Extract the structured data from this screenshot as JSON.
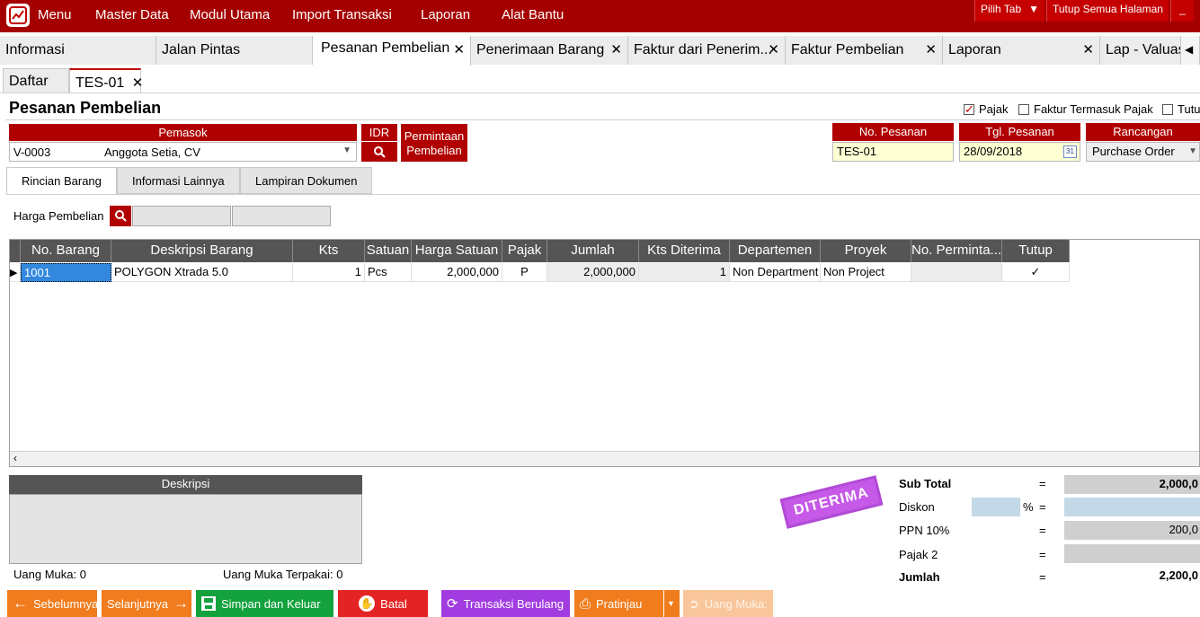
{
  "menubar": {
    "items": [
      "Menu",
      "Master Data",
      "Modul Utama",
      "Import Transaksi",
      "Laporan",
      "Alat Bantu"
    ],
    "pilih_tab": "Pilih Tab",
    "tutup_semua": "Tutup Semua Halaman",
    "minimize": "_",
    "colors": {
      "bar": "#a50000"
    }
  },
  "main_tabs": [
    {
      "label": "Informasi"
    },
    {
      "label": "Jalan Pintas"
    },
    {
      "label": "Pesanan Pembelian",
      "active": true
    },
    {
      "label": "Penerimaan Barang"
    },
    {
      "label": "Faktur dari Penerim..."
    },
    {
      "label": "Faktur Pembelian"
    },
    {
      "label": "Laporan"
    },
    {
      "label": "Lap - Valuas"
    }
  ],
  "sub_tabs": {
    "list": "Daftar",
    "current": "TES-01"
  },
  "form": {
    "title": "Pesanan Pembelian",
    "checkboxes": {
      "pajak": "Pajak",
      "faktur_termasuk_pajak": "Faktur Termasuk Pajak",
      "tutup": "Tutu"
    },
    "pemasok_label": "Pemasok",
    "pemasok_code": "V-0003",
    "pemasok_name": "Anggota Setia, CV",
    "currency": "IDR",
    "permintaan_line1": "Permintaan",
    "permintaan_line2": "Pembelian",
    "no_pesanan_label": "No. Pesanan",
    "no_pesanan": "TES-01",
    "tgl_pesanan_label": "Tgl. Pesanan",
    "tgl_pesanan": "28/09/2018",
    "calendar_day": "31",
    "rancangan_label": "Rancangan",
    "rancangan": "Purchase Order"
  },
  "inner_tabs": [
    "Rincian Barang",
    "Informasi Lainnya",
    "Lampiran Dokumen"
  ],
  "harga_pembelian_label": "Harga Pembelian",
  "grid": {
    "columns": [
      "No. Barang",
      "Deskripsi Barang",
      "Kts",
      "Satuan",
      "Harga Satuan",
      "Pajak",
      "Jumlah",
      "Kts Diterima",
      "Departemen",
      "Proyek",
      "No. Perminta...",
      "Tutup"
    ],
    "rows": [
      {
        "no_barang": "1001",
        "deskripsi": "POLYGON Xtrada 5.0",
        "kts": "1",
        "satuan": "Pcs",
        "harga": "2,000,000",
        "pajak": "P",
        "jumlah": "2,000,000",
        "kts_diterima": "1",
        "departemen": "Non Department",
        "proyek": "Non Project",
        "no_permintaan": "",
        "tutup": "✓"
      }
    ]
  },
  "description": {
    "label": "Deskripsi"
  },
  "uang_muka": "Uang Muka: 0",
  "uang_muka_terpakai": "Uang Muka Terpakai: 0",
  "stamp": "DITERIMA",
  "summary": {
    "sub_total_label": "Sub Total",
    "sub_total": "2,000,0",
    "diskon_label": "Diskon",
    "percent": "%",
    "ppn_label": "PPN 10%",
    "ppn": "200,0",
    "pajak2_label": "Pajak 2",
    "jumlah_label": "Jumlah",
    "jumlah": "2,200,0",
    "eq": "="
  },
  "buttons": {
    "prev": "Sebelumnya",
    "next": "Selanjutnya",
    "save": "Simpan dan Keluar",
    "cancel": "Batal",
    "recurring": "Transaksi Berulang",
    "preview": "Pratinjau",
    "down_payment": "Uang Muka:"
  }
}
